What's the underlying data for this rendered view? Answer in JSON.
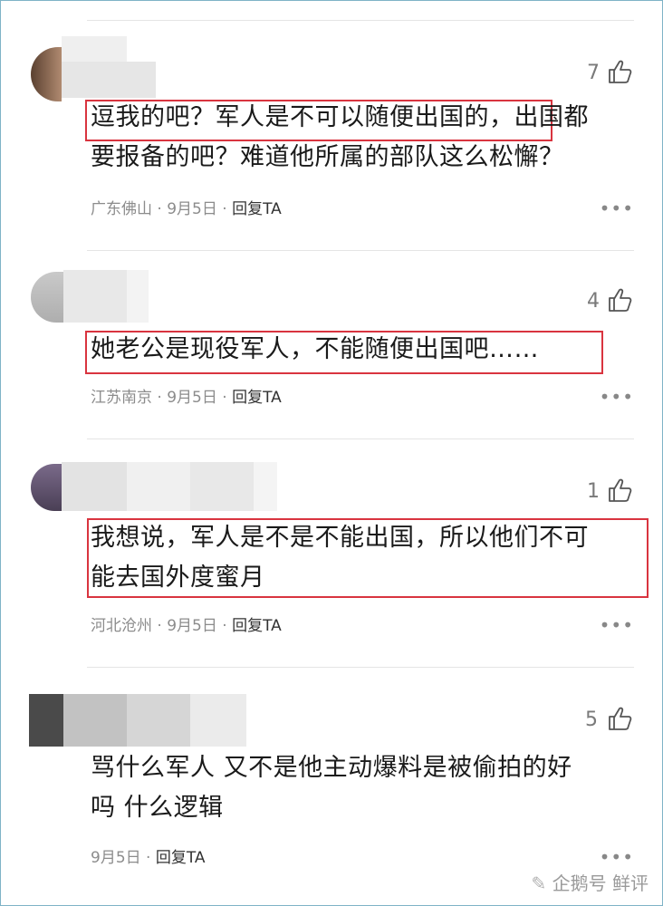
{
  "comments": [
    {
      "likes": "7",
      "lines": [
        "逗我的吧？军人是不可以随便出国的，出国都",
        "要报备的吧？难道他所属的部队这么松懈？"
      ],
      "location": "广东佛山",
      "date": "9月5日",
      "reply": "回复TA"
    },
    {
      "likes": "4",
      "lines": [
        "她老公是现役军人，不能随便出国吧……"
      ],
      "location": "江苏南京",
      "date": "9月5日",
      "reply": "回复TA"
    },
    {
      "likes": "1",
      "lines": [
        "我想说，军人是不是不能出国，所以他们不可",
        "能去国外度蜜月"
      ],
      "location": "河北沧州",
      "date": "9月5日",
      "reply": "回复TA"
    },
    {
      "likes": "5",
      "lines": [
        "骂什么军人 又不是他主动爆料是被偷拍的好",
        "吗 什么逻辑"
      ],
      "location": "",
      "date": "9月5日",
      "reply": "回复TA"
    }
  ],
  "more_label": "•••",
  "meta_separator": "·",
  "watermark": "企鹅号 鲜评",
  "colors": {
    "highlight": "#d9343f",
    "meta": "#8c8c8c",
    "frame": "#7fb3c7"
  }
}
